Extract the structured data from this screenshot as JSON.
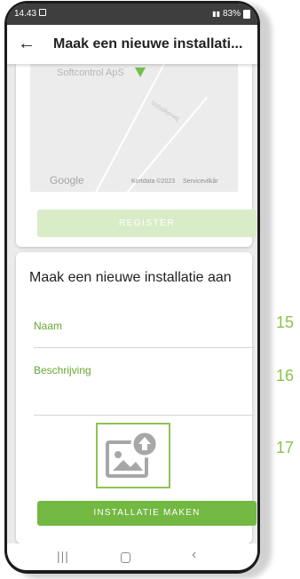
{
  "status_bar": {
    "time": "14.43",
    "battery": "83%"
  },
  "app_bar": {
    "back_icon": "arrow-back-icon",
    "title": "Maak een nieuwe installati..."
  },
  "map": {
    "company_label": "Softcontrol ApS",
    "street_label": "Volsdkervej",
    "google_logo": "Google",
    "map_data": "Kortdata ©2023",
    "terms": "Servicevilkår"
  },
  "register_button": "REGISTER",
  "form": {
    "heading": "Maak een nieuwe installatie aan",
    "name_label": "Naam",
    "description_label": "Beschrijving",
    "image_icon": "add-image-upload-icon",
    "create_button": "INSTALLATIE MAKEN"
  },
  "annotations": [
    "15",
    "16",
    "17"
  ],
  "colors": {
    "accent_green": "#73b842",
    "disabled_green": "#d8ecc8",
    "label_green": "#6aa534",
    "status_bar": "#3e3e3e"
  }
}
